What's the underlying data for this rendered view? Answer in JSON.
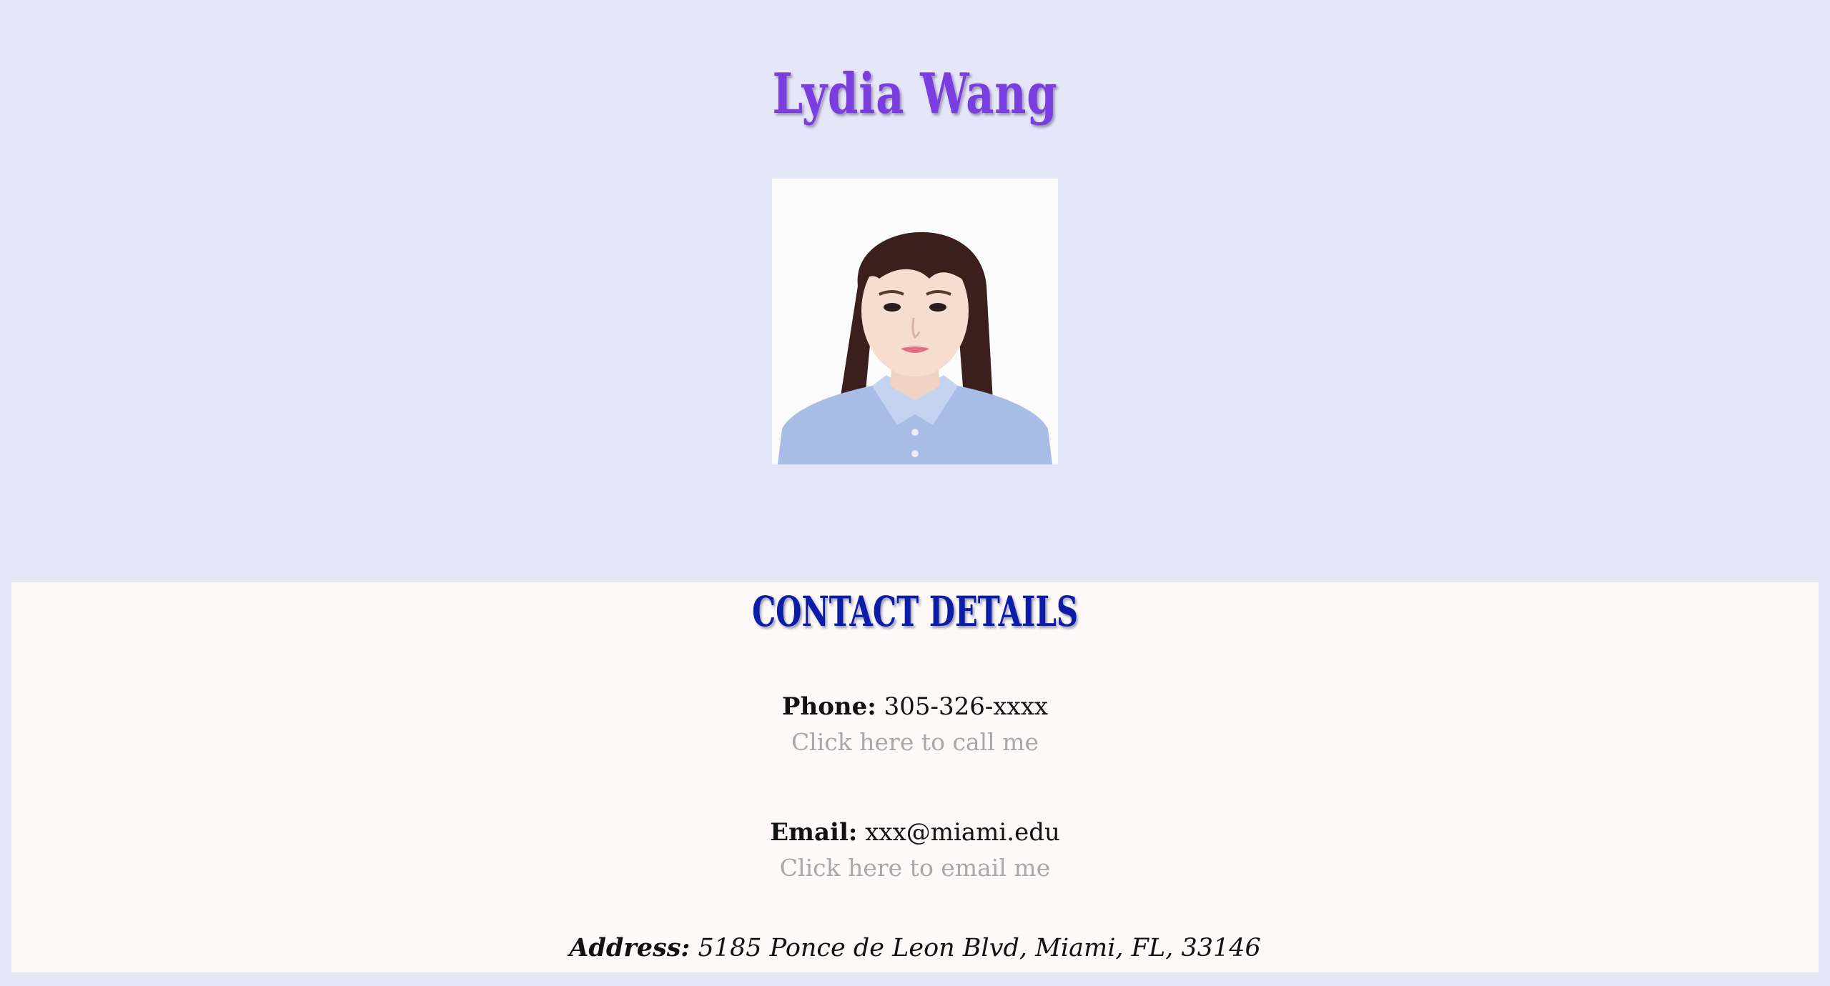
{
  "profile": {
    "name": "Lydia Wang"
  },
  "contact": {
    "title": "CONTACT DETAILS",
    "phone_label": "Phone:",
    "phone_value": "305-326-xxxx",
    "phone_link": "Click here to call me",
    "email_label": "Email:",
    "email_value": "xxx@miami.edu",
    "email_link": "Click here to email me",
    "address_label": "Address:",
    "address_value": "5185 Ponce de Leon Blvd, Miami, FL, 33146"
  },
  "colors": {
    "page_background": "#e5e6f8",
    "name_color": "#7a3ee0",
    "contact_title_color": "#0a1ca8",
    "contact_background": "#fcf9f8",
    "link_color": "#a8a8a8"
  }
}
